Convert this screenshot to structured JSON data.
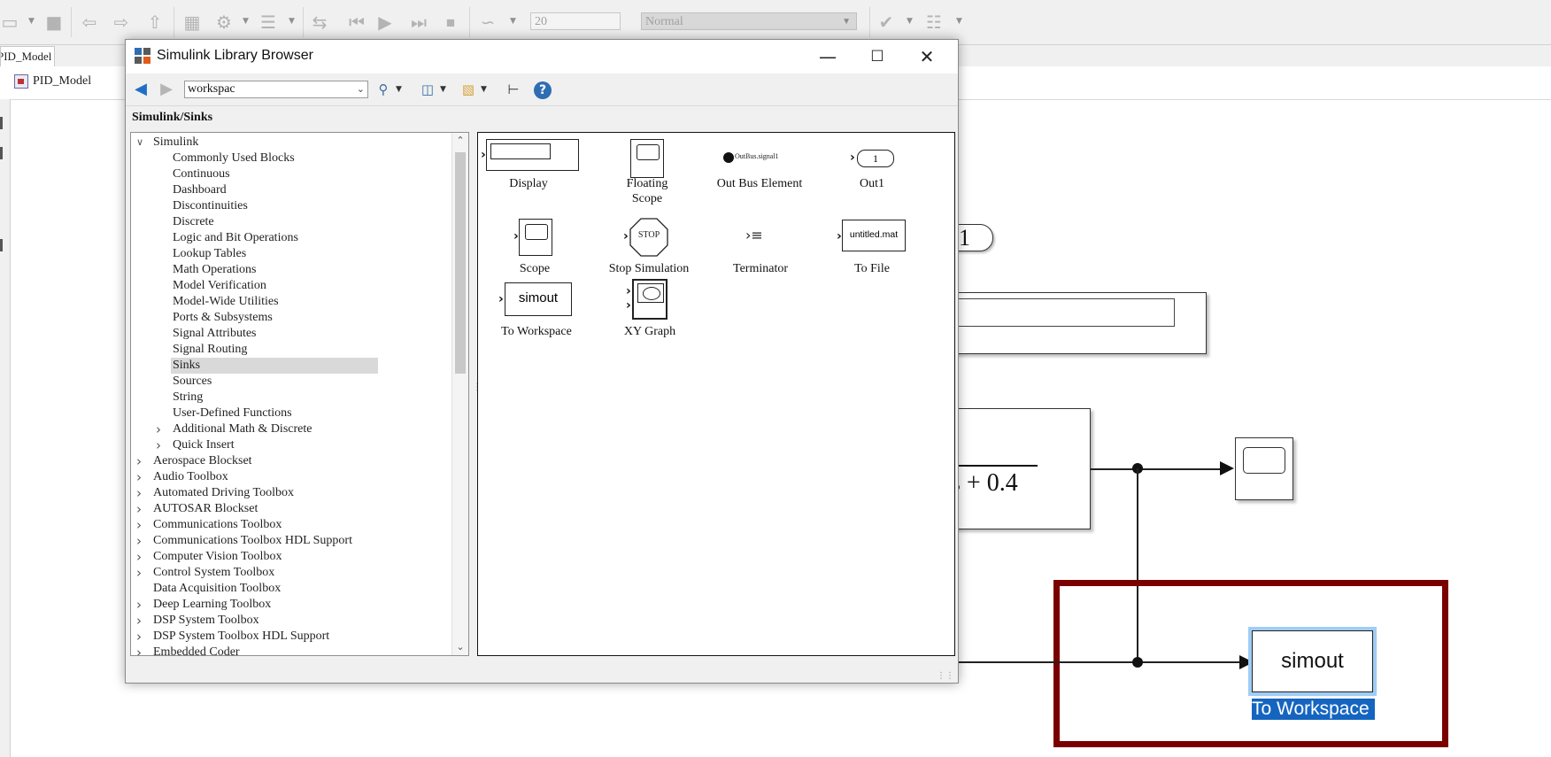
{
  "toolbar": {
    "stop_time": "20",
    "sim_mode": "Normal"
  },
  "model_tab": {
    "label": "PID_Model"
  },
  "breadcrumb": {
    "label": "PID_Model"
  },
  "canvas": {
    "outport_value": "1",
    "transfer_fn_tail": "s + 0.4",
    "workspace_block": {
      "text": "simout",
      "label": "To Workspace"
    }
  },
  "library_browser": {
    "title": "Simulink Library Browser",
    "search_value": "workspac",
    "path": "Simulink/Sinks",
    "tree": [
      {
        "label": "Simulink",
        "level": 0,
        "expander": "expanded"
      },
      {
        "label": "Commonly Used Blocks",
        "level": 1,
        "expander": "none"
      },
      {
        "label": "Continuous",
        "level": 1,
        "expander": "none"
      },
      {
        "label": "Dashboard",
        "level": 1,
        "expander": "none"
      },
      {
        "label": "Discontinuities",
        "level": 1,
        "expander": "none"
      },
      {
        "label": "Discrete",
        "level": 1,
        "expander": "none"
      },
      {
        "label": "Logic and Bit Operations",
        "level": 1,
        "expander": "none"
      },
      {
        "label": "Lookup Tables",
        "level": 1,
        "expander": "none"
      },
      {
        "label": "Math Operations",
        "level": 1,
        "expander": "none"
      },
      {
        "label": "Model Verification",
        "level": 1,
        "expander": "none"
      },
      {
        "label": "Model-Wide Utilities",
        "level": 1,
        "expander": "none"
      },
      {
        "label": "Ports & Subsystems",
        "level": 1,
        "expander": "none"
      },
      {
        "label": "Signal Attributes",
        "level": 1,
        "expander": "none"
      },
      {
        "label": "Signal Routing",
        "level": 1,
        "expander": "none"
      },
      {
        "label": "Sinks",
        "level": 1,
        "expander": "none",
        "selected": true
      },
      {
        "label": "Sources",
        "level": 1,
        "expander": "none"
      },
      {
        "label": "String",
        "level": 1,
        "expander": "none"
      },
      {
        "label": "User-Defined Functions",
        "level": 1,
        "expander": "none"
      },
      {
        "label": "Additional Math & Discrete",
        "level": 1,
        "expander": "collapsed"
      },
      {
        "label": "Quick Insert",
        "level": 1,
        "expander": "collapsed"
      },
      {
        "label": "Aerospace Blockset",
        "level": 0,
        "expander": "collapsed"
      },
      {
        "label": "Audio Toolbox",
        "level": 0,
        "expander": "collapsed"
      },
      {
        "label": "Automated Driving Toolbox",
        "level": 0,
        "expander": "collapsed"
      },
      {
        "label": "AUTOSAR Blockset",
        "level": 0,
        "expander": "collapsed"
      },
      {
        "label": "Communications Toolbox",
        "level": 0,
        "expander": "collapsed"
      },
      {
        "label": "Communications Toolbox HDL Support",
        "level": 0,
        "expander": "collapsed"
      },
      {
        "label": "Computer Vision Toolbox",
        "level": 0,
        "expander": "collapsed"
      },
      {
        "label": "Control System Toolbox",
        "level": 0,
        "expander": "collapsed"
      },
      {
        "label": "Data Acquisition Toolbox",
        "level": 0,
        "expander": "none"
      },
      {
        "label": "Deep Learning Toolbox",
        "level": 0,
        "expander": "collapsed"
      },
      {
        "label": "DSP System Toolbox",
        "level": 0,
        "expander": "collapsed"
      },
      {
        "label": "DSP System Toolbox HDL Support",
        "level": 0,
        "expander": "collapsed"
      },
      {
        "label": "Embedded Coder",
        "level": 0,
        "expander": "collapsed"
      }
    ],
    "blocks": [
      {
        "id": "display",
        "label": "Display"
      },
      {
        "id": "floating-scope",
        "label": "Floating\nScope"
      },
      {
        "id": "out-bus-element",
        "label": "Out Bus Element",
        "icon_text": "OutBus.signal1"
      },
      {
        "id": "out1",
        "label": "Out1",
        "icon_text": "1"
      },
      {
        "id": "scope",
        "label": "Scope"
      },
      {
        "id": "stop-simulation",
        "label": "Stop Simulation",
        "icon_text": "STOP"
      },
      {
        "id": "terminator",
        "label": "Terminator"
      },
      {
        "id": "to-file",
        "label": "To File",
        "icon_text": "untitled.mat"
      },
      {
        "id": "to-workspace",
        "label": "To Workspace",
        "icon_text": "simout"
      },
      {
        "id": "xy-graph",
        "label": "XY Graph"
      }
    ]
  }
}
